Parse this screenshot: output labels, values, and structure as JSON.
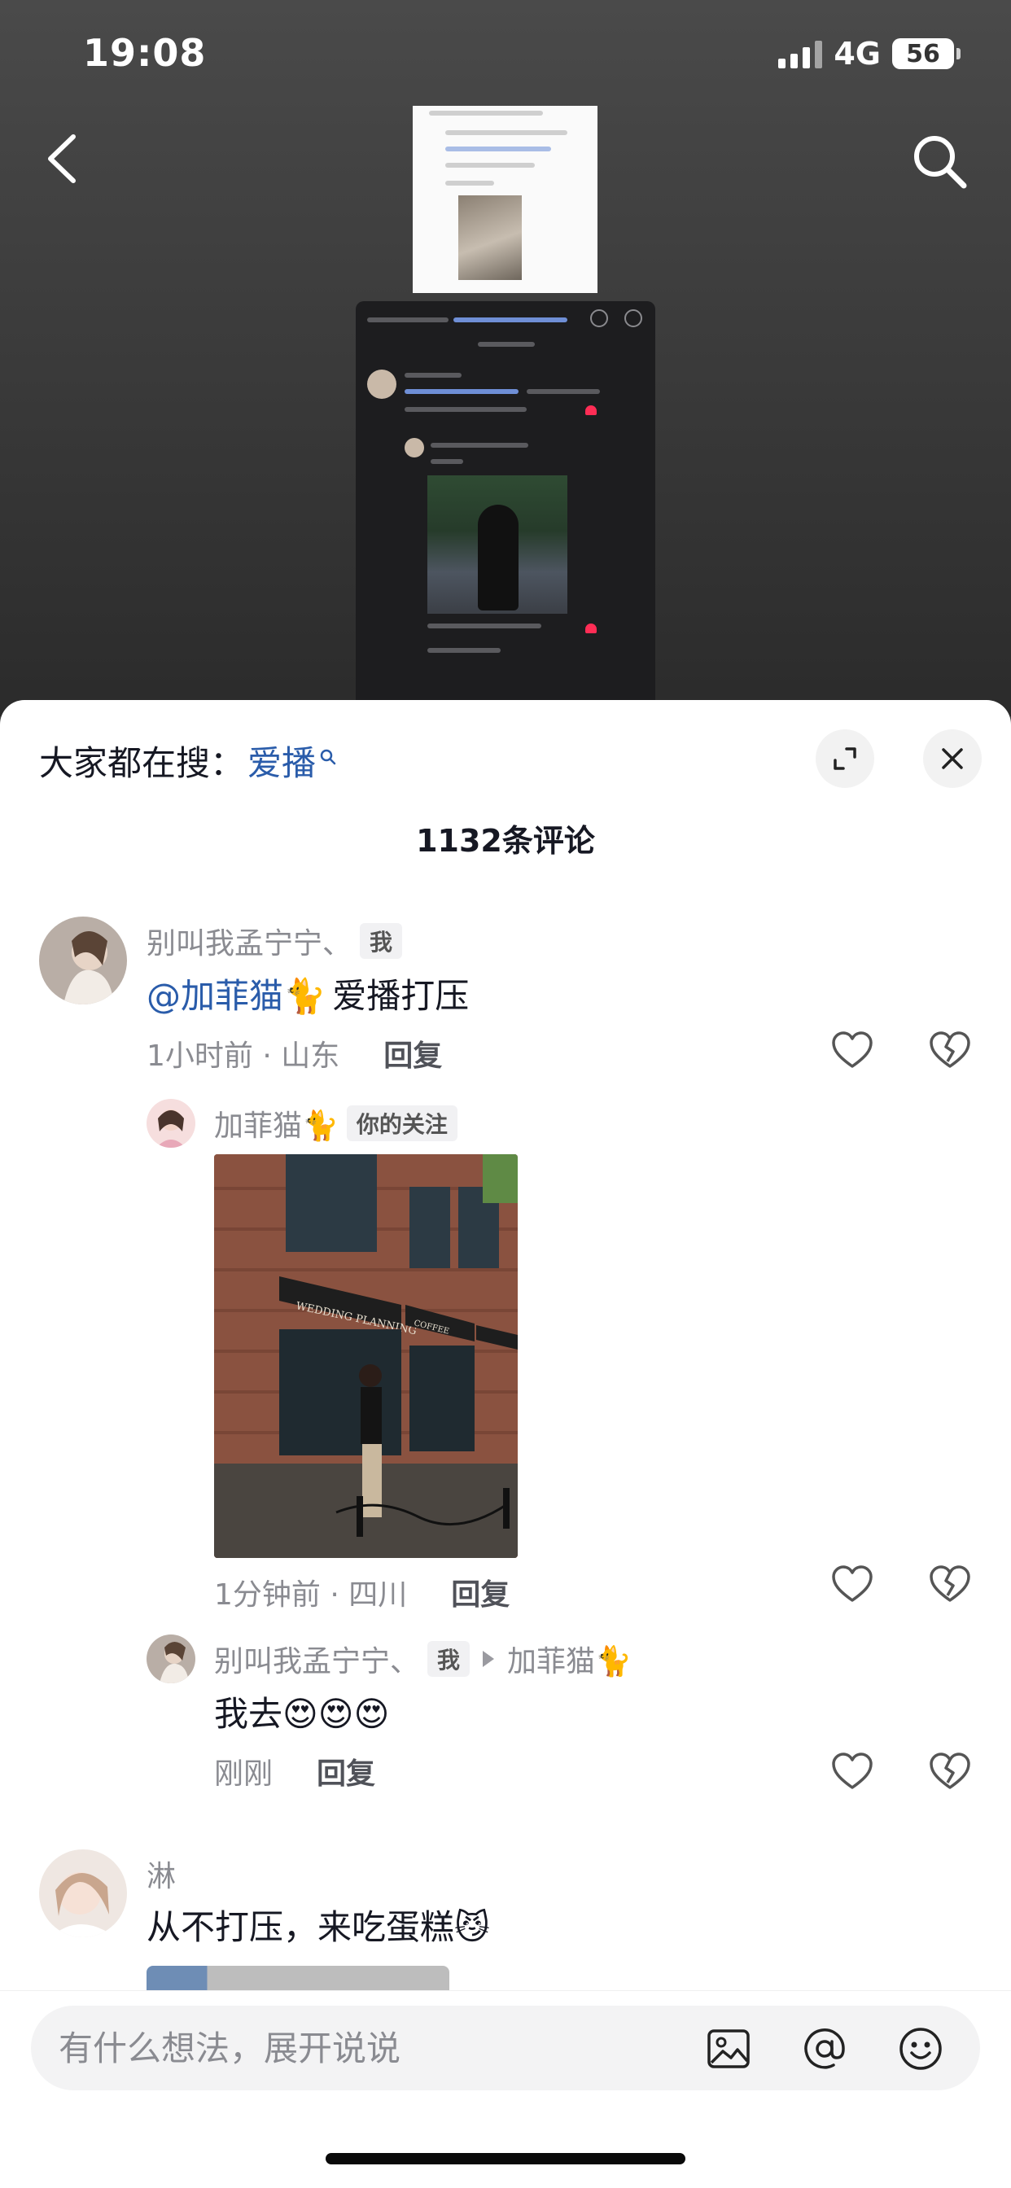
{
  "status_bar": {
    "time": "19:08",
    "network": "4G",
    "battery": "56"
  },
  "sheet": {
    "search_hint_prefix": "大家都在搜：",
    "search_keyword": "爱播",
    "comment_count_title": "1132条评论"
  },
  "comments": [
    {
      "username": "别叫我孟宁宁、",
      "tag": "我",
      "mention": "@加菲猫🐈",
      "text": "爱播打压",
      "time_location": "1小时前 · 山东",
      "reply_label": "回复"
    },
    {
      "username": "加菲猫🐈",
      "tag": "你的关注",
      "time_location": "1分钟前 · 四川",
      "reply_label": "回复",
      "photo_signs": [
        "WEDDING PLANNING",
        "COFFEE"
      ]
    },
    {
      "username": "别叫我孟宁宁、",
      "tag": "我",
      "reply_to": "加菲猫🐈",
      "text": "我去😍😍😍",
      "time_location": "刚刚",
      "reply_label": "回复"
    },
    {
      "username": "淋",
      "text": "从不打压，来吃蛋糕😼"
    }
  ],
  "input": {
    "placeholder": "有什么想法，展开说说"
  },
  "icons": {
    "back": "back-arrow-icon",
    "search": "search-icon",
    "expand": "expand-icon",
    "close": "close-icon",
    "like": "heart-icon",
    "dislike": "broken-heart-icon",
    "image": "image-icon",
    "mention": "at-icon",
    "emoji": "smile-icon"
  },
  "colors": {
    "mention_blue": "#2a5caa",
    "secondary_text": "#8a8b91",
    "primary_text": "#161823"
  }
}
